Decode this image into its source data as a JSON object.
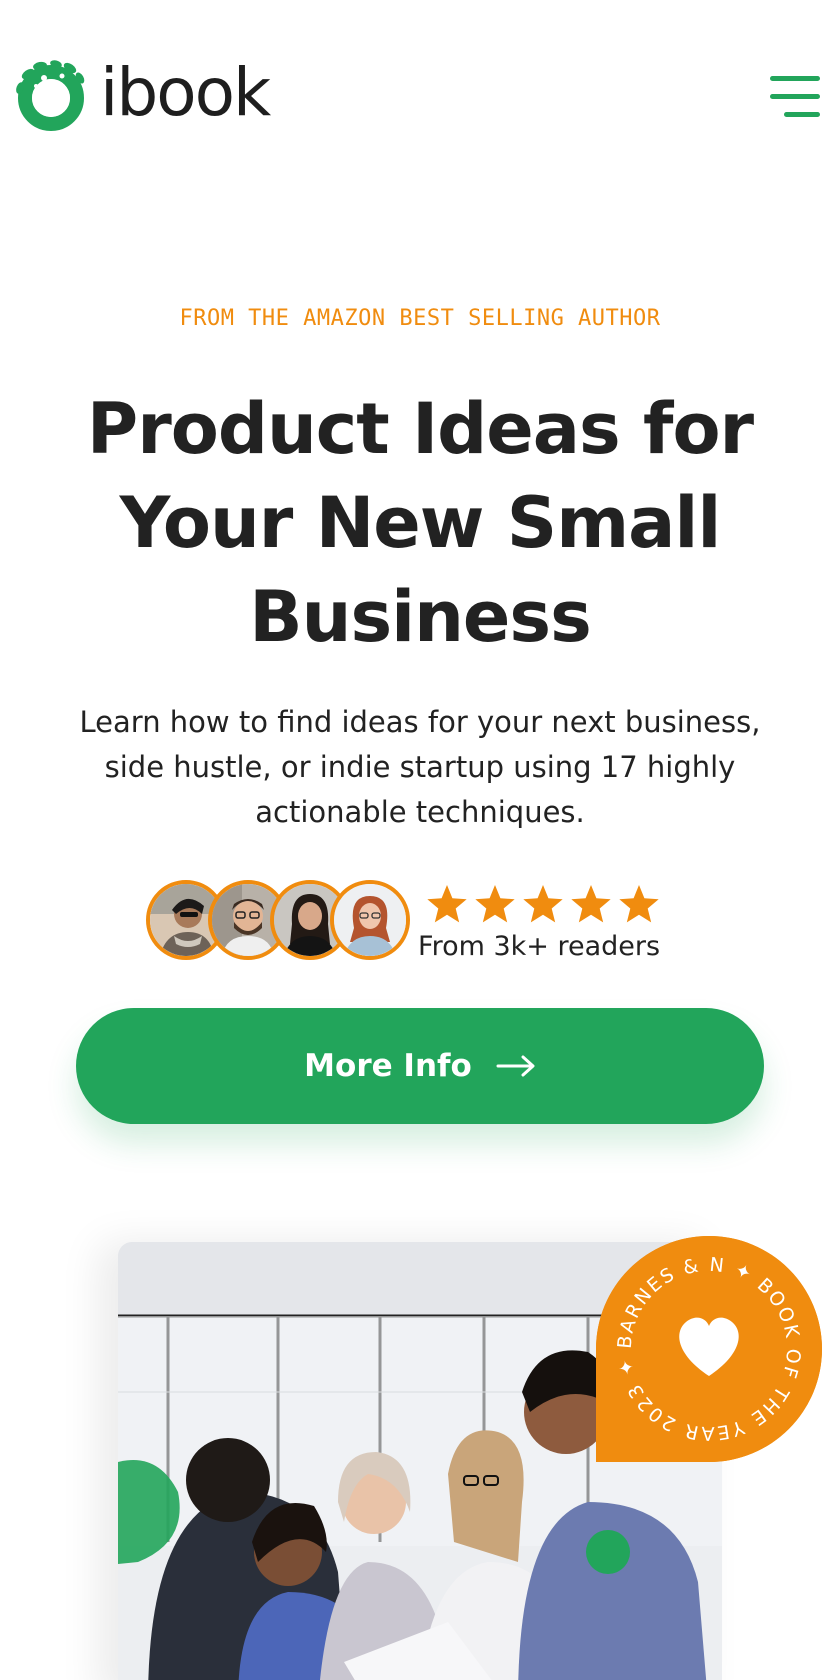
{
  "header": {
    "logo_text": "ibook",
    "menu_icon": "hamburger-menu-icon"
  },
  "hero": {
    "eyebrow": "FROM THE AMAZON BEST SELLING AUTHOR",
    "title": "Product Ideas for Your New Small Business",
    "subtitle": "Learn how to find ideas for your next business, side hustle, or indie startup using 17 highly actionable techniques.",
    "rating": {
      "stars": 5,
      "readers_text": "From 3k+ readers"
    },
    "cta": {
      "label": "More Info",
      "icon": "arrow-right-icon"
    }
  },
  "badge": {
    "text": "BARNES & N ✦ BOOK OF THE YEAR 2023 ✦",
    "icon": "heart-icon"
  },
  "colors": {
    "brand_green": "#22a55b",
    "accent_orange": "#f08c0f",
    "text_dark": "#222222"
  }
}
